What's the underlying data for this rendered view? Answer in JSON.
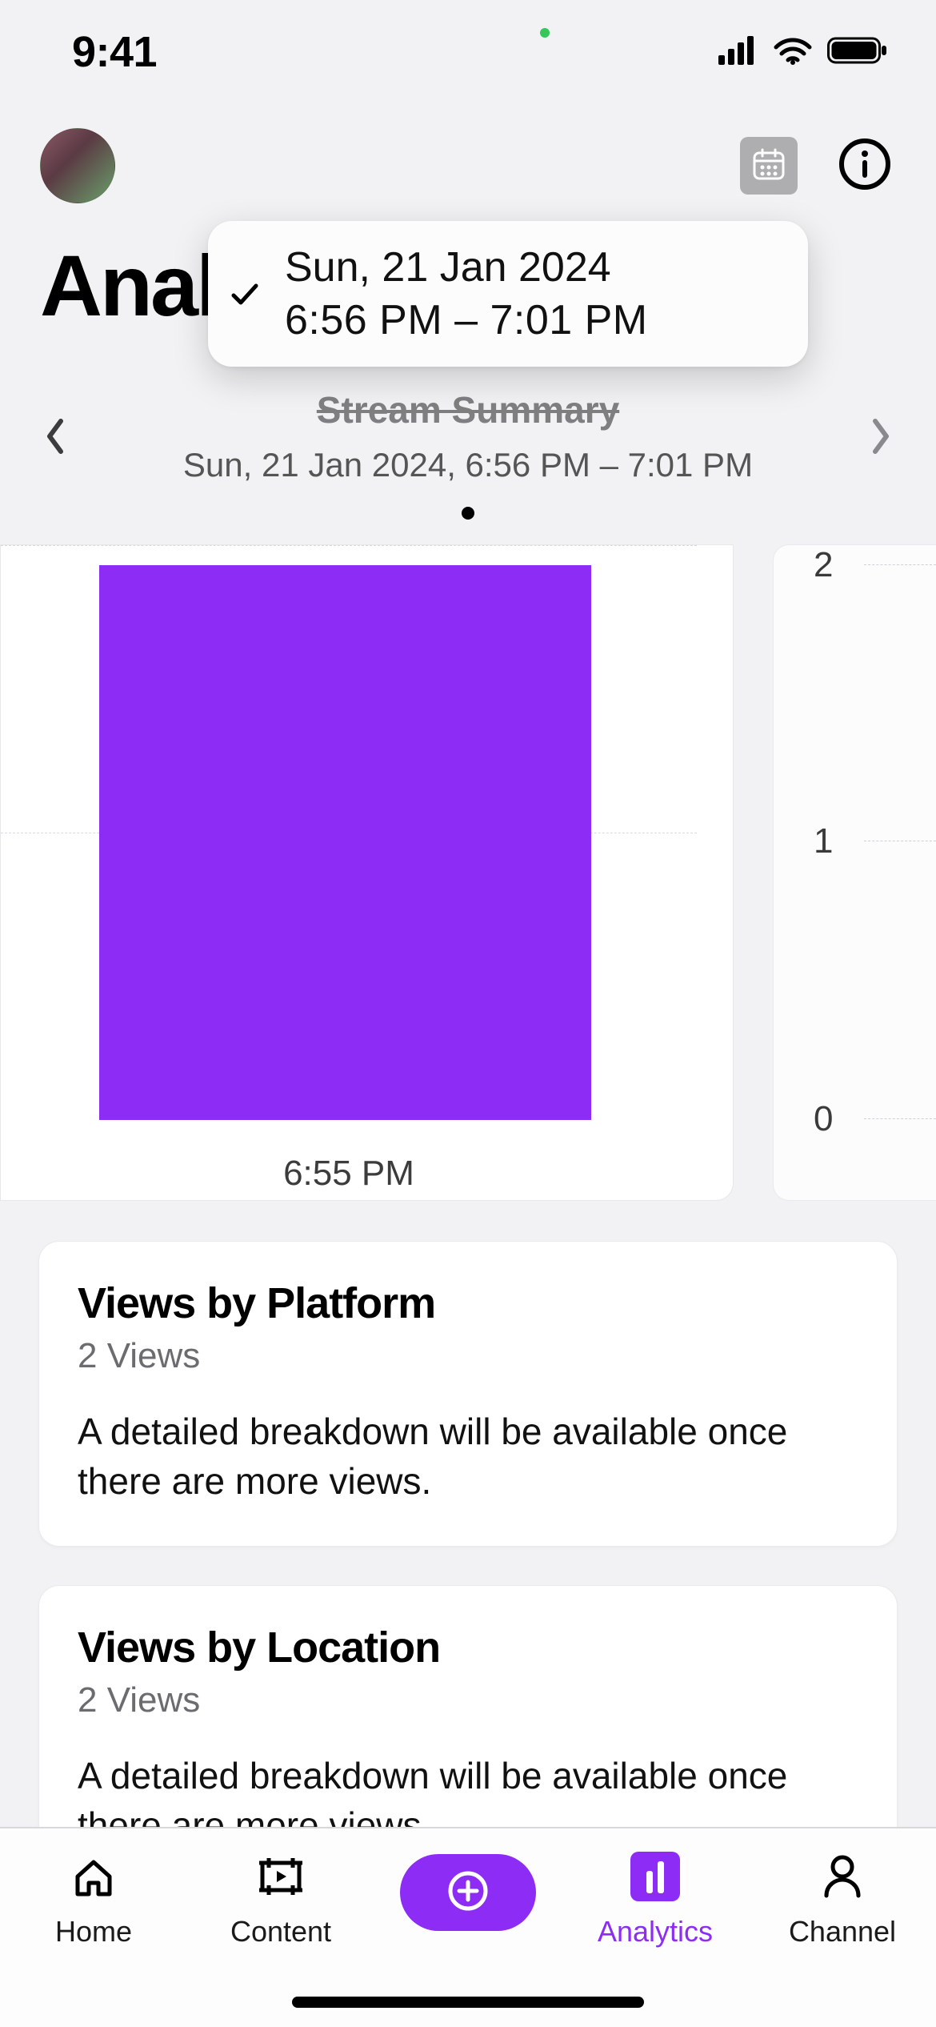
{
  "status": {
    "time": "9:41"
  },
  "header": {
    "page_title": "Analytics"
  },
  "popover": {
    "line1": "Sun, 21 Jan 2024",
    "line2": "6:56 PM – 7:01 PM"
  },
  "summary": {
    "title": "Stream Summary",
    "range": "Sun, 21 Jan 2024, 6:56 PM – 7:01 PM"
  },
  "chart_data": {
    "type": "bar",
    "categories": [
      "6:55 PM"
    ],
    "values": [
      2
    ],
    "xlabel": "6:55 PM",
    "ylabel": "",
    "ylim": [
      0,
      2
    ],
    "yticks": [
      0,
      1,
      2
    ]
  },
  "cards": [
    {
      "title": "Views by Platform",
      "subtitle": "2 Views",
      "body": "A detailed breakdown will be available once there are more views."
    },
    {
      "title": "Views by Location",
      "subtitle": "2 Views",
      "body": "A detailed breakdown will be available once there are more views."
    }
  ],
  "tabs": {
    "home": "Home",
    "content": "Content",
    "analytics": "Analytics",
    "channel": "Channel"
  },
  "colors": {
    "accent": "#8c2cf4"
  }
}
